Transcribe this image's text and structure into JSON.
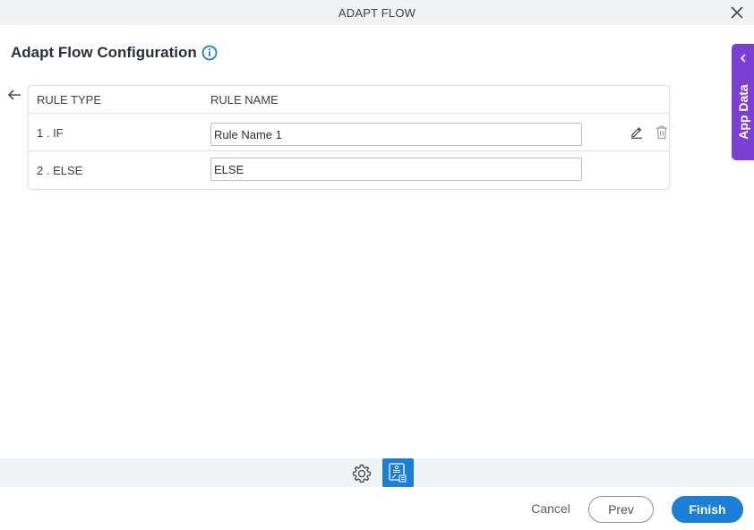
{
  "window": {
    "title": "ADAPT FLOW",
    "close_icon": "close-icon"
  },
  "header": {
    "title": "Adapt Flow Configuration",
    "info_icon": "info-icon"
  },
  "grid": {
    "columns": [
      "RULE TYPE",
      "RULE NAME"
    ],
    "rows": [
      {
        "type": "1 . IF",
        "name": "Rule Name 1",
        "actions": [
          "edit-icon",
          "trash-icon"
        ]
      },
      {
        "type": "2 . ELSE",
        "name": "ELSE"
      }
    ]
  },
  "side_panel": {
    "label": "App Data"
  },
  "toolbar": {
    "icons": [
      "gear-icon",
      "adapt-flow-icon"
    ],
    "active": "adapt-flow-icon"
  },
  "footer": {
    "cancel_label": "Cancel",
    "prev_label": "Prev",
    "finish_label": "Finish"
  },
  "colors": {
    "accent": "#1b7fd6",
    "side_panel": "#7c3fd6",
    "bar_background": "#f1f2f4"
  }
}
